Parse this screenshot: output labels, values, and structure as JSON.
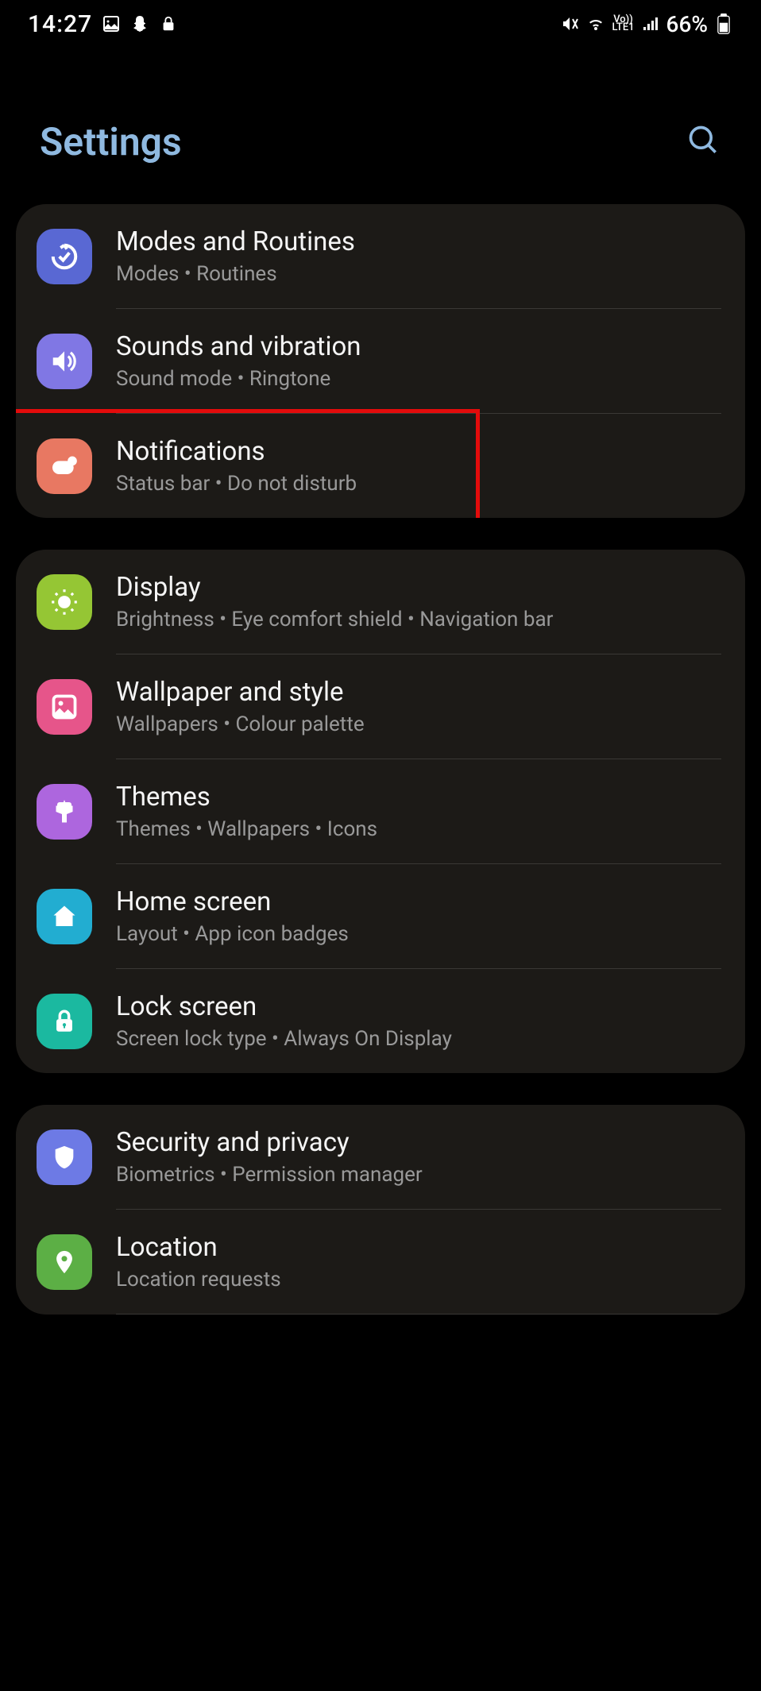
{
  "status": {
    "time": "14:27",
    "battery": "66%",
    "lte": "LTE1",
    "volte": "Vo))"
  },
  "header": {
    "title": "Settings"
  },
  "groups": [
    {
      "items": [
        {
          "id": "modes",
          "title": "Modes and Routines",
          "subtitle": "Modes  •  Routines",
          "iconColor": "#5968D3"
        },
        {
          "id": "sounds",
          "title": "Sounds and vibration",
          "subtitle": "Sound mode  •  Ringtone",
          "iconColor": "#8077E4"
        },
        {
          "id": "notifications",
          "title": "Notifications",
          "subtitle": "Status bar  •  Do not disturb",
          "iconColor": "#E87862",
          "highlighted": true
        }
      ]
    },
    {
      "items": [
        {
          "id": "display",
          "title": "Display",
          "subtitle": "Brightness  •  Eye comfort shield  •  Navigation bar",
          "iconColor": "#95C634"
        },
        {
          "id": "wallpaper",
          "title": "Wallpaper and style",
          "subtitle": "Wallpapers  •  Colour palette",
          "iconColor": "#E6558A"
        },
        {
          "id": "themes",
          "title": "Themes",
          "subtitle": "Themes  •  Wallpapers  •  Icons",
          "iconColor": "#AD66DE"
        },
        {
          "id": "homescreen",
          "title": "Home screen",
          "subtitle": "Layout  •  App icon badges",
          "iconColor": "#22ADD1"
        },
        {
          "id": "lockscreen",
          "title": "Lock screen",
          "subtitle": "Screen lock type  •  Always On Display",
          "iconColor": "#1BB9A0"
        }
      ]
    },
    {
      "items": [
        {
          "id": "security",
          "title": "Security and privacy",
          "subtitle": "Biometrics  •  Permission manager",
          "iconColor": "#6D7AE5"
        },
        {
          "id": "location",
          "title": "Location",
          "subtitle": "Location requests",
          "iconColor": "#5CAF45"
        }
      ]
    }
  ]
}
